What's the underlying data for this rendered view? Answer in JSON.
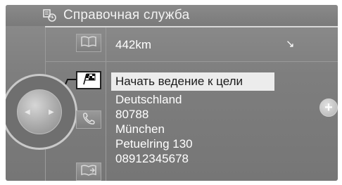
{
  "header": {
    "title": "Справочная служба",
    "icon": "directory-service-icon"
  },
  "entry": {
    "distance": "442km",
    "direction_arrow": "↘",
    "ghost_name": "...",
    "start_guidance": "Начать ведение к цели",
    "country": "Deutschland",
    "postal_code": "80788",
    "city": "München",
    "street": "Petuelring 130",
    "phone": "08912345678"
  },
  "side_buttons": [
    {
      "icon": "book-icon"
    },
    {
      "icon": "checkered-flag-icon",
      "selected": true
    },
    {
      "icon": "phone-handset-icon"
    },
    {
      "icon": "book-export-icon"
    }
  ],
  "controls": {
    "plus_label": "+"
  },
  "colors": {
    "background": "#7e7e7e",
    "highlight": "#ececec",
    "text": "#ffffff"
  }
}
